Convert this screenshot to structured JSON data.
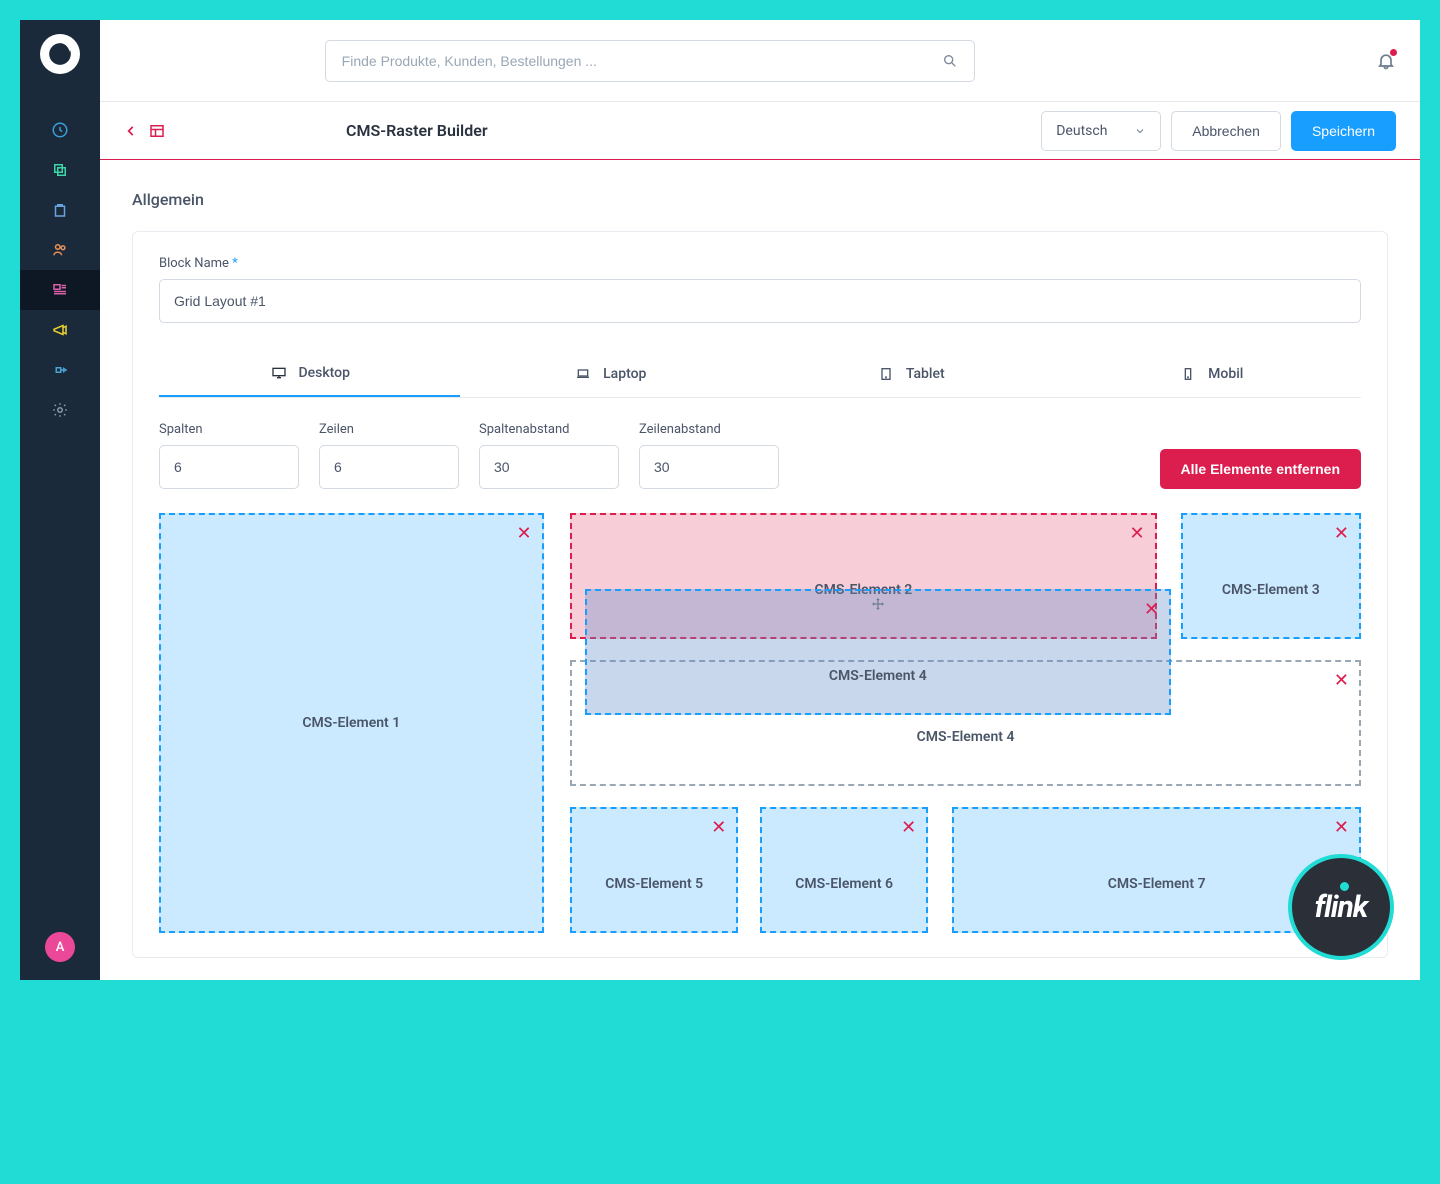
{
  "search": {
    "placeholder": "Finde Produkte, Kunden, Bestellungen ..."
  },
  "header": {
    "title": "CMS-Raster Builder",
    "language": "Deutsch",
    "cancel": "Abbrechen",
    "save": "Speichern"
  },
  "general": {
    "section_title": "Allgemein",
    "block_name_label": "Block Name",
    "block_name_value": "Grid Layout #1"
  },
  "tabs": {
    "desktop": "Desktop",
    "laptop": "Laptop",
    "tablet": "Tablet",
    "mobile": "Mobil"
  },
  "controls": {
    "cols_label": "Spalten",
    "cols_value": "6",
    "rows_label": "Zeilen",
    "rows_value": "6",
    "colgap_label": "Spaltenabstand",
    "colgap_value": "30",
    "rowgap_label": "Zeilenabstand",
    "rowgap_value": "30",
    "remove_all": "Alle Elemente entfernen"
  },
  "elements": {
    "e1": "CMS-Element 1",
    "e2": "CMS-Element 2",
    "e3": "CMS-Element 3",
    "e4_drag": "CMS-Element 4",
    "e4": "CMS-Element 4",
    "e5": "CMS-Element 5",
    "e6": "CMS-Element 6",
    "e7": "CMS-Element 7"
  },
  "avatar": "A",
  "brand": "flink"
}
